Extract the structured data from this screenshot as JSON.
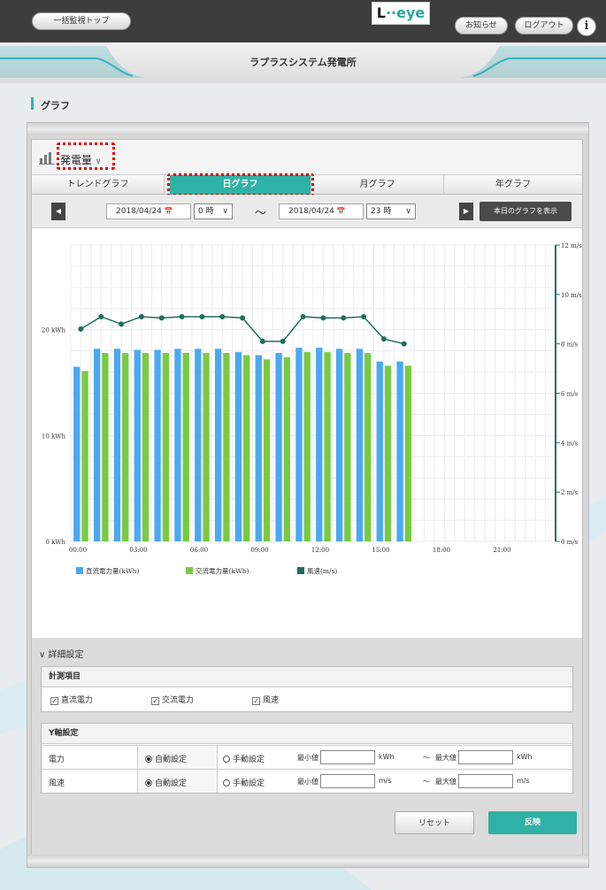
{
  "topbar": {
    "bulk_top_label": "一括監視トップ",
    "logo_text": "L",
    "logo_accent": "··eye",
    "notice_label": "お知らせ",
    "logout_label": "ログアウト",
    "info_label": "i"
  },
  "header": {
    "plant_name": "ラプラスシステム発電所"
  },
  "section": {
    "title": "グラフ"
  },
  "measure": {
    "selected": "発電量",
    "arrow": "∨"
  },
  "tabs": [
    {
      "label": "トレンドグラフ",
      "active": false
    },
    {
      "label": "日グラフ",
      "active": true
    },
    {
      "label": "月グラフ",
      "active": false
    },
    {
      "label": "年グラフ",
      "active": false
    }
  ],
  "daterange": {
    "prev": "◀",
    "next": "▶",
    "start_date": "2018/04/24",
    "start_hour": "0 時",
    "tilde": "～",
    "end_date": "2018/04/24",
    "end_hour": "23 時",
    "today_label": "本日のグラフを表示",
    "calendar_glyph": "📅",
    "chevron": "∨"
  },
  "chart_data": {
    "type": "bar",
    "categories": [
      "00:00",
      "01:00",
      "02:00",
      "03:00",
      "04:00",
      "05:00",
      "06:00",
      "07:00",
      "08:00",
      "09:00",
      "10:00",
      "11:00",
      "12:00",
      "13:00",
      "14:00",
      "15:00",
      "16:00",
      "17:00",
      "18:00",
      "19:00",
      "20:00",
      "21:00",
      "22:00",
      "23:00"
    ],
    "x_ticks": [
      "00:00",
      "03:00",
      "06:00",
      "09:00",
      "12:00",
      "15:00",
      "18:00",
      "21:00"
    ],
    "y_left_ticks": [
      "0 kWh",
      "10 kWh",
      "20 kWh"
    ],
    "y_right_ticks": [
      "0 m/s",
      "2 m/s",
      "4 m/s",
      "6 m/s",
      "8 m/s",
      "10 m/s",
      "12 m/s"
    ],
    "ylim_left": [
      0,
      28
    ],
    "ylim_right": [
      0,
      12
    ],
    "series": [
      {
        "name": "直流電力量(kWh)",
        "kind": "bar",
        "axis": "left",
        "color": "#4aa9f2",
        "values": [
          16.5,
          18.2,
          18.2,
          18.1,
          18.1,
          18.2,
          18.2,
          18.2,
          17.6,
          17.8,
          18.3,
          18.3,
          17.0,
          null,
          null,
          null,
          null,
          null,
          null,
          null,
          null,
          null,
          null,
          null
        ]
      },
      {
        "name": "交流電力量(kWh)",
        "kind": "bar",
        "axis": "left",
        "color": "#7ac943",
        "values": [
          16.1,
          17.8,
          17.8,
          17.8,
          17.8,
          17.8,
          17.8,
          17.8,
          17.2,
          17.4,
          17.9,
          17.9,
          16.6,
          null,
          null,
          null,
          null,
          null,
          null,
          null,
          null,
          null,
          null,
          null
        ]
      },
      {
        "name": "風速(m/s)",
        "kind": "line",
        "axis": "right",
        "color": "#1f6e5c",
        "values": [
          8.6,
          9.1,
          8.8,
          9.1,
          9.0,
          9.0,
          9.0,
          9.0,
          8.1,
          9.1,
          9.0,
          9.0,
          8.2,
          7.9,
          null,
          null,
          null,
          null,
          null,
          null,
          null,
          null,
          null,
          null
        ],
        "x_offsets": [
          0,
          1,
          2,
          3,
          4,
          5,
          6,
          7,
          8,
          9,
          10,
          11,
          12,
          13
        ]
      }
    ],
    "wind_points": [
      {
        "x": 0,
        "y": 8.6
      },
      {
        "x": 1,
        "y": 9.1
      },
      {
        "x": 2,
        "y": 8.8
      },
      {
        "x": 3,
        "y": 9.1
      },
      {
        "x": 4,
        "y": 9.05
      },
      {
        "x": 5,
        "y": 9.1
      },
      {
        "x": 6,
        "y": 9.1
      },
      {
        "x": 7,
        "y": 9.1
      },
      {
        "x": 8,
        "y": 9.05
      },
      {
        "x": 9,
        "y": 8.1
      },
      {
        "x": 10,
        "y": 8.1
      },
      {
        "x": 11,
        "y": 9.1
      },
      {
        "x": 12,
        "y": 9.05
      },
      {
        "x": 13,
        "y": 9.05
      },
      {
        "x": 14,
        "y": 9.1
      },
      {
        "x": 15,
        "y": 8.2
      },
      {
        "x": 16,
        "y": 8.0
      }
    ],
    "dc_values": [
      16.5,
      18.2,
      18.2,
      18.1,
      18.1,
      18.2,
      18.2,
      18.2,
      17.6,
      17.8,
      18.3,
      18.3,
      17.0
    ],
    "ac_values": [
      16.1,
      17.8,
      17.8,
      17.8,
      17.8,
      17.8,
      17.8,
      17.8,
      17.2,
      17.4,
      17.9,
      17.9,
      16.6
    ],
    "bar_hours": 17,
    "dc_all": [
      16.5,
      18.2,
      18.2,
      18.1,
      18.1,
      18.2,
      18.2,
      18.2,
      17.9,
      17.6,
      17.8,
      18.3,
      18.3,
      18.2,
      18.2,
      17.0,
      17.0
    ],
    "ac_all": [
      16.1,
      17.8,
      17.8,
      17.8,
      17.8,
      17.8,
      17.8,
      17.8,
      17.6,
      17.2,
      17.4,
      17.9,
      17.9,
      17.8,
      17.8,
      16.6,
      16.6
    ],
    "grid": true,
    "legend_position": "bottom-left"
  },
  "details": {
    "title": "詳細設定",
    "toggle": "∨",
    "measure_items": {
      "heading": "計測項目",
      "items": [
        "直流電力",
        "交流電力",
        "風速"
      ],
      "check_glyph": "✓"
    },
    "yaxis": {
      "heading": "Y軸設定",
      "rows": [
        {
          "label": "電力",
          "auto": "自動設定",
          "manual": "手動設定",
          "min_label": "最小値",
          "max_label": "最大値",
          "unit": "kWh",
          "tilde": "～"
        },
        {
          "label": "風速",
          "auto": "自動設定",
          "manual": "手動設定",
          "min_label": "最小値",
          "max_label": "最大値",
          "unit": "m/s",
          "tilde": "～"
        }
      ]
    },
    "reset_label": "リセット",
    "apply_label": "反映"
  },
  "colors": {
    "accent": "#2fb2a6",
    "topbar": "#3d3d3d",
    "highlight": "#e00000"
  }
}
